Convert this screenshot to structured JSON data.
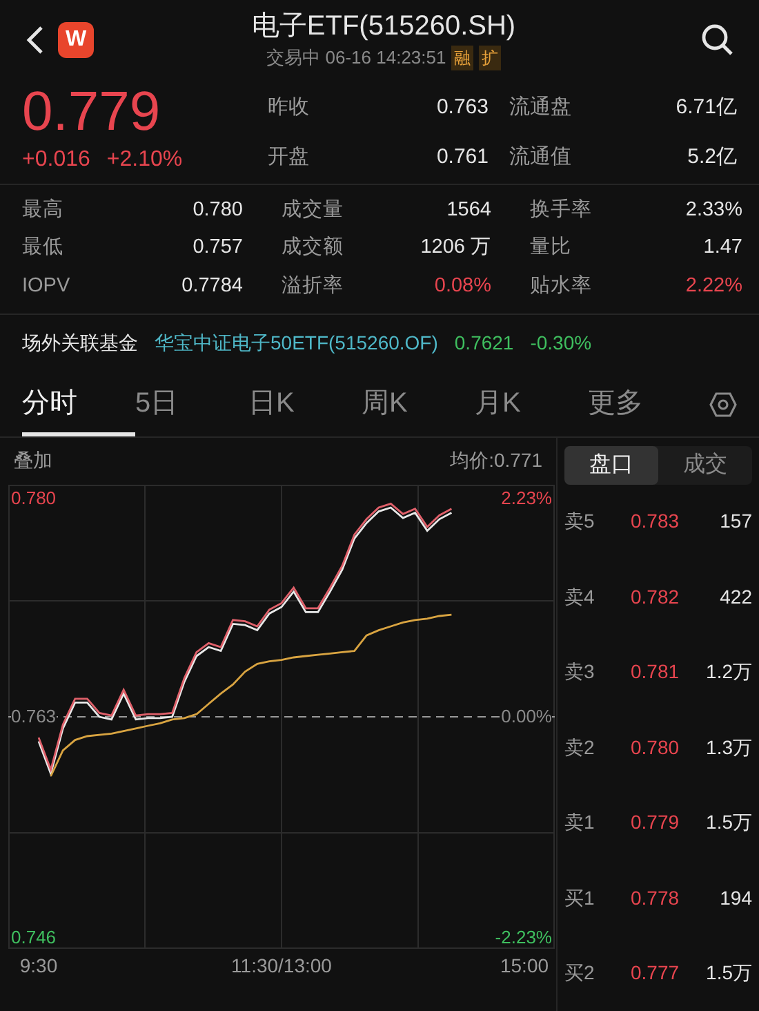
{
  "header": {
    "title": "电子ETF(515260.SH)",
    "status": "交易中",
    "datetime": "06-16 14:23:51",
    "badges": [
      "融",
      "扩"
    ],
    "logo": "W"
  },
  "quote": {
    "price": "0.779",
    "change": "+0.016",
    "change_pct": "+2.10%",
    "fields": [
      {
        "label": "昨收",
        "value": "0.763"
      },
      {
        "label": "流通盘",
        "value": "6.71亿"
      },
      {
        "label": "开盘",
        "value": "0.761"
      },
      {
        "label": "流通值",
        "value": "5.2亿"
      }
    ]
  },
  "stats": [
    {
      "label": "最高",
      "value": "0.780",
      "color": "#e6e6e6"
    },
    {
      "label": "成交量",
      "value": "1564",
      "color": "#e6e6e6"
    },
    {
      "label": "换手率",
      "value": "2.33%",
      "color": "#e6e6e6"
    },
    {
      "label": "最低",
      "value": "0.757",
      "color": "#e6e6e6"
    },
    {
      "label": "成交额",
      "value": "1206 万",
      "color": "#e6e6e6"
    },
    {
      "label": "量比",
      "value": "1.47",
      "color": "#e6e6e6"
    },
    {
      "label": "IOPV",
      "value": "0.7784",
      "color": "#e6e6e6"
    },
    {
      "label": "溢折率",
      "value": "0.08%",
      "color": "#e8454f"
    },
    {
      "label": "贴水率",
      "value": "2.22%",
      "color": "#e8454f"
    }
  ],
  "related_fund": {
    "label": "场外关联基金",
    "name": "华宝中证电子50ETF(515260.OF)",
    "price": "0.7621",
    "change": "-0.30%"
  },
  "tabs": [
    {
      "label": "分时",
      "selected": true
    },
    {
      "label": "5日",
      "selected": false
    },
    {
      "label": "日K",
      "selected": false
    },
    {
      "label": "周K",
      "selected": false
    },
    {
      "label": "月K",
      "selected": false
    },
    {
      "label": "更多",
      "selected": false
    }
  ],
  "chart": {
    "overlay_label": "叠加",
    "avg_label": "均价:0.771",
    "top_pct": "2.23%",
    "mid_pct": "0.00%",
    "bottom_pct": "-2.23%",
    "chart_data": {
      "type": "line",
      "ylim": [
        0.746,
        0.78
      ],
      "ref_lines": [
        {
          "axis": "y",
          "value": 0.763
        }
      ],
      "yticks": [
        {
          "value": 0.78,
          "label": "0.780"
        },
        {
          "value": 0.763,
          "label": "0.763"
        },
        {
          "value": 0.746,
          "label": "0.746"
        }
      ],
      "categories": [
        "9:30",
        null,
        null,
        null,
        null,
        null,
        null,
        null,
        null,
        null,
        null,
        null,
        null,
        null,
        null,
        null,
        null,
        null,
        null,
        null,
        "11:30/13:00",
        null,
        null,
        null,
        null,
        null,
        null,
        null,
        null,
        null,
        null,
        null,
        null,
        null,
        null,
        null,
        null,
        null,
        null,
        null,
        "15:00"
      ],
      "series": [
        {
          "color": "#e8e8e8",
          "values": [
            0.7611,
            0.7586,
            0.7621,
            0.7641,
            0.7641,
            0.763,
            0.7628,
            0.7648,
            0.7628,
            0.7629,
            0.7629,
            0.763,
            0.7657,
            0.7677,
            0.7684,
            0.7681,
            0.7702,
            0.7701,
            0.7697,
            0.771,
            0.7715,
            0.7727,
            0.7711,
            0.7711,
            0.7727,
            0.7744,
            0.7768,
            0.778,
            0.7789,
            0.7792,
            0.7784,
            0.7788,
            0.7774,
            0.7783,
            0.7788,
            null,
            null,
            null,
            null,
            null,
            null
          ]
        },
        {
          "color": "#e0606a",
          "values": [
            0.7614,
            0.7589,
            0.7624,
            0.7644,
            0.7644,
            0.7633,
            0.7631,
            0.7651,
            0.7631,
            0.7632,
            0.7632,
            0.7633,
            0.766,
            0.768,
            0.7687,
            0.7684,
            0.7705,
            0.7704,
            0.77,
            0.7713,
            0.7718,
            0.773,
            0.7714,
            0.7714,
            0.773,
            0.7747,
            0.7771,
            0.7783,
            0.7792,
            0.7795,
            0.7787,
            0.7791,
            0.7777,
            0.7786,
            0.7791,
            null,
            null,
            null,
            null,
            null,
            null
          ]
        },
        {
          "color": "#d9a441",
          "values": [
            null,
            0.7584,
            0.7604,
            0.7612,
            0.7615,
            0.7616,
            0.7617,
            0.7619,
            0.7621,
            0.7623,
            0.7625,
            0.7628,
            0.7629,
            0.7632,
            0.764,
            0.7648,
            0.7655,
            0.7665,
            0.7671,
            0.7673,
            0.7674,
            0.7676,
            0.7677,
            0.7678,
            0.7679,
            0.768,
            0.7681,
            0.7693,
            0.7697,
            0.77,
            0.7703,
            0.7705,
            0.7706,
            0.7708,
            0.7709,
            null,
            null,
            null,
            null,
            null,
            null
          ]
        }
      ]
    }
  },
  "order_book": {
    "tabs": [
      {
        "label": "盘口",
        "selected": true
      },
      {
        "label": "成交",
        "selected": false
      }
    ],
    "rows": [
      {
        "label": "卖5",
        "price": "0.783",
        "volume": "157"
      },
      {
        "label": "卖4",
        "price": "0.782",
        "volume": "422"
      },
      {
        "label": "卖3",
        "price": "0.781",
        "volume": "1.2万"
      },
      {
        "label": "卖2",
        "price": "0.780",
        "volume": "1.3万"
      },
      {
        "label": "卖1",
        "price": "0.779",
        "volume": "1.5万"
      },
      {
        "label": "买1",
        "price": "0.778",
        "volume": "194"
      },
      {
        "label": "买2",
        "price": "0.777",
        "volume": "1.5万"
      }
    ]
  }
}
